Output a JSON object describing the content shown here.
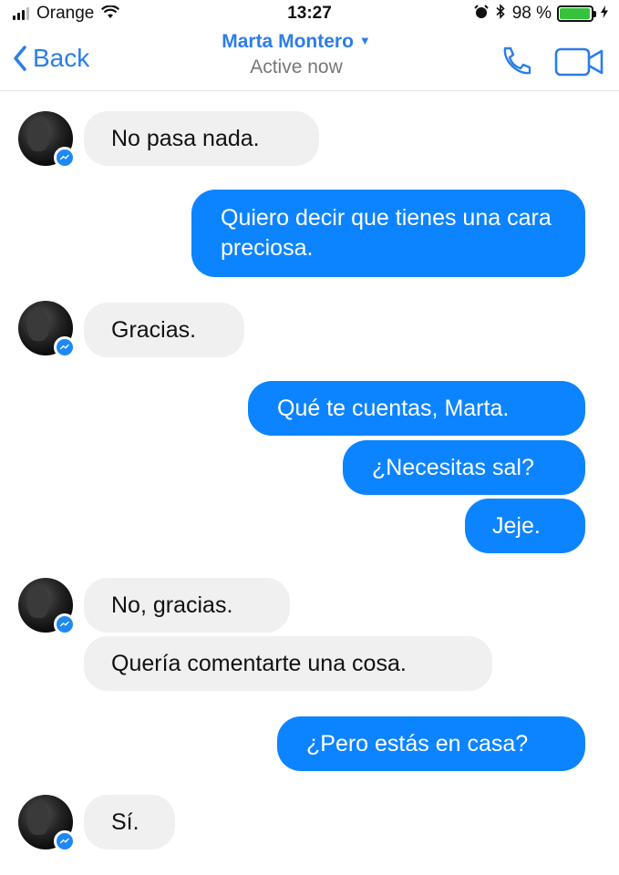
{
  "status_bar": {
    "carrier": "Orange",
    "time": "13:27",
    "battery_percent": "98 %",
    "battery_level": 0.98
  },
  "nav": {
    "back_label": "Back",
    "contact_name": "Marta Montero",
    "contact_status": "Active now",
    "caret": "▼"
  },
  "messages": [
    {
      "side": "incoming",
      "text": "No pasa nada."
    },
    {
      "side": "outgoing",
      "text": "Quiero decir que tienes una cara preciosa."
    },
    {
      "side": "incoming",
      "text": "Gracias."
    },
    {
      "side": "outgoing",
      "text": "Qué te cuentas, Marta."
    },
    {
      "side": "outgoing",
      "text": "¿Necesitas sal?"
    },
    {
      "side": "outgoing",
      "text": "Jeje."
    },
    {
      "side": "incoming",
      "text": "No, gracias."
    },
    {
      "side": "incoming",
      "text": "Quería comentarte una cosa."
    },
    {
      "side": "outgoing",
      "text": "¿Pero estás en casa?"
    },
    {
      "side": "incoming",
      "text": "Sí."
    }
  ],
  "colors": {
    "accent": "#2b7de9",
    "outgoing_bubble": "#0d84ff",
    "incoming_bubble": "#f0f0f0",
    "battery_fill": "#36c23b"
  },
  "icons": [
    "signal-bars-icon",
    "wifi-icon",
    "alarm-icon",
    "bluetooth-icon",
    "battery-icon",
    "charging-bolt-icon",
    "back-chevron-icon",
    "phone-call-icon",
    "video-call-icon",
    "messenger-badge-icon"
  ]
}
